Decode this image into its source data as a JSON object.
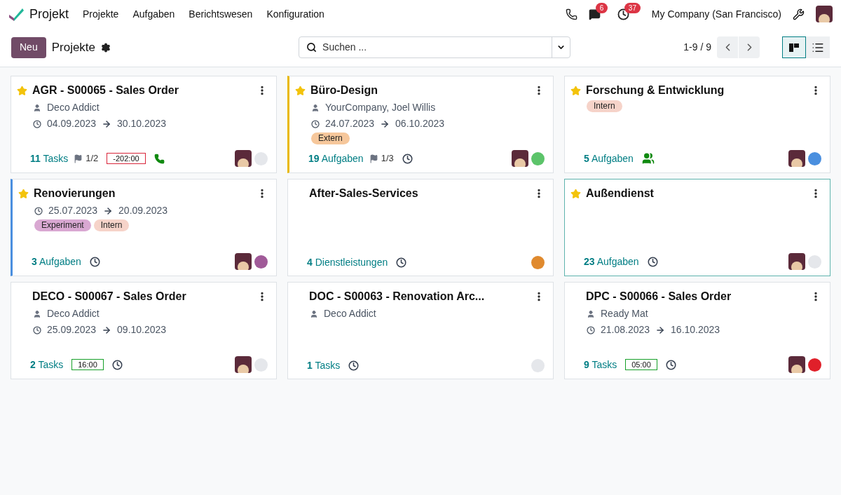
{
  "navbar": {
    "app": "Projekt",
    "menu": [
      "Projekte",
      "Aufgaben",
      "Berichtswesen",
      "Konfiguration"
    ],
    "messages_count": "6",
    "activities_count": "37",
    "company": "My Company (San Francisco)"
  },
  "control_panel": {
    "new_button": "Neu",
    "title": "Projekte",
    "search": {
      "placeholder": "Suchen ..."
    },
    "pager": "1-9 / 9",
    "views": [
      {
        "kind": "kanban",
        "selected": true
      },
      {
        "kind": "list",
        "selected": false
      }
    ]
  },
  "projects": [
    {
      "name": "AGR - S00065 - Sales Order",
      "favorite": true,
      "selected": false,
      "partner": "Deco Addict",
      "start": "04.09.2023",
      "end": "30.10.2023",
      "count": "11",
      "count_label": "Tasks",
      "milestones": "1/2",
      "timesheet": {
        "text": "-202:00",
        "kind": "over"
      },
      "activity": {
        "kind": "phone"
      },
      "avatar": true,
      "status": {
        "color": "#e5e7eb"
      }
    },
    {
      "name": "Büro-Design",
      "favorite": true,
      "selected": false,
      "stripe": {
        "color": "#e9b800"
      },
      "partner": "YourCompany, Joel Willis",
      "start": "24.07.2023",
      "end": "06.10.2023",
      "tags": [
        {
          "label": "Extern",
          "color": "#f6c79b"
        }
      ],
      "count": "19",
      "count_label": "Aufgaben",
      "milestones": "1/3",
      "activity": {
        "kind": "clock"
      },
      "avatar": true,
      "status": {
        "color": "#5cc46a"
      }
    },
    {
      "name": "Forschung & Entwicklung",
      "favorite": true,
      "selected": false,
      "tags": [
        {
          "label": "Intern",
          "color": "#f6d3c9"
        }
      ],
      "count": "5",
      "count_label": "Aufgaben",
      "activity": {
        "kind": "team"
      },
      "avatar": true,
      "status": {
        "color": "#4a8fdf"
      }
    },
    {
      "name": "Renovierungen",
      "favorite": true,
      "selected": false,
      "stripe": {
        "color": "#4a8fdf"
      },
      "start": "25.07.2023",
      "end": "20.09.2023",
      "tags": [
        {
          "label": "Experiment",
          "color": "#d9a8d2"
        },
        {
          "label": "Intern",
          "color": "#f6d3c9"
        }
      ],
      "count": "3",
      "count_label": "Aufgaben",
      "activity": {
        "kind": "clock"
      },
      "avatar": true,
      "status": {
        "color": "#a05a98"
      }
    },
    {
      "name": "After-Sales-Services",
      "favorite": false,
      "selected": false,
      "count": "4",
      "count_label": "Dienstleistungen",
      "activity": {
        "kind": "clock"
      },
      "avatar": false,
      "status": {
        "color": "#e08a2e"
      }
    },
    {
      "name": "Außendienst",
      "favorite": true,
      "selected": true,
      "count": "23",
      "count_label": "Aufgaben",
      "activity": {
        "kind": "clock"
      },
      "avatar": true,
      "status": {
        "color": "#e5e7eb"
      }
    },
    {
      "name": "DECO - S00067 - Sales Order",
      "favorite": false,
      "selected": false,
      "partner": "Deco Addict",
      "start": "25.09.2023",
      "end": "09.10.2023",
      "count": "2",
      "count_label": "Tasks",
      "timesheet": {
        "text": "16:00",
        "kind": "ok"
      },
      "activity": {
        "kind": "clock"
      },
      "avatar": true,
      "status": {
        "color": "#e5e7eb"
      }
    },
    {
      "name": "DOC - S00063 - Renovation Arc...",
      "favorite": false,
      "selected": false,
      "partner": "Deco Addict",
      "count": "1",
      "count_label": "Tasks",
      "activity": {
        "kind": "clock"
      },
      "avatar": false,
      "status": {
        "color": "#e5e7eb"
      }
    },
    {
      "name": "DPC - S00066 - Sales Order",
      "favorite": false,
      "selected": false,
      "partner": "Ready Mat",
      "start": "21.08.2023",
      "end": "16.10.2023",
      "count": "9",
      "count_label": "Tasks",
      "timesheet": {
        "text": "05:00",
        "kind": "ok"
      },
      "activity": {
        "kind": "clock"
      },
      "avatar": true,
      "status": {
        "color": "#e0202a"
      }
    }
  ]
}
